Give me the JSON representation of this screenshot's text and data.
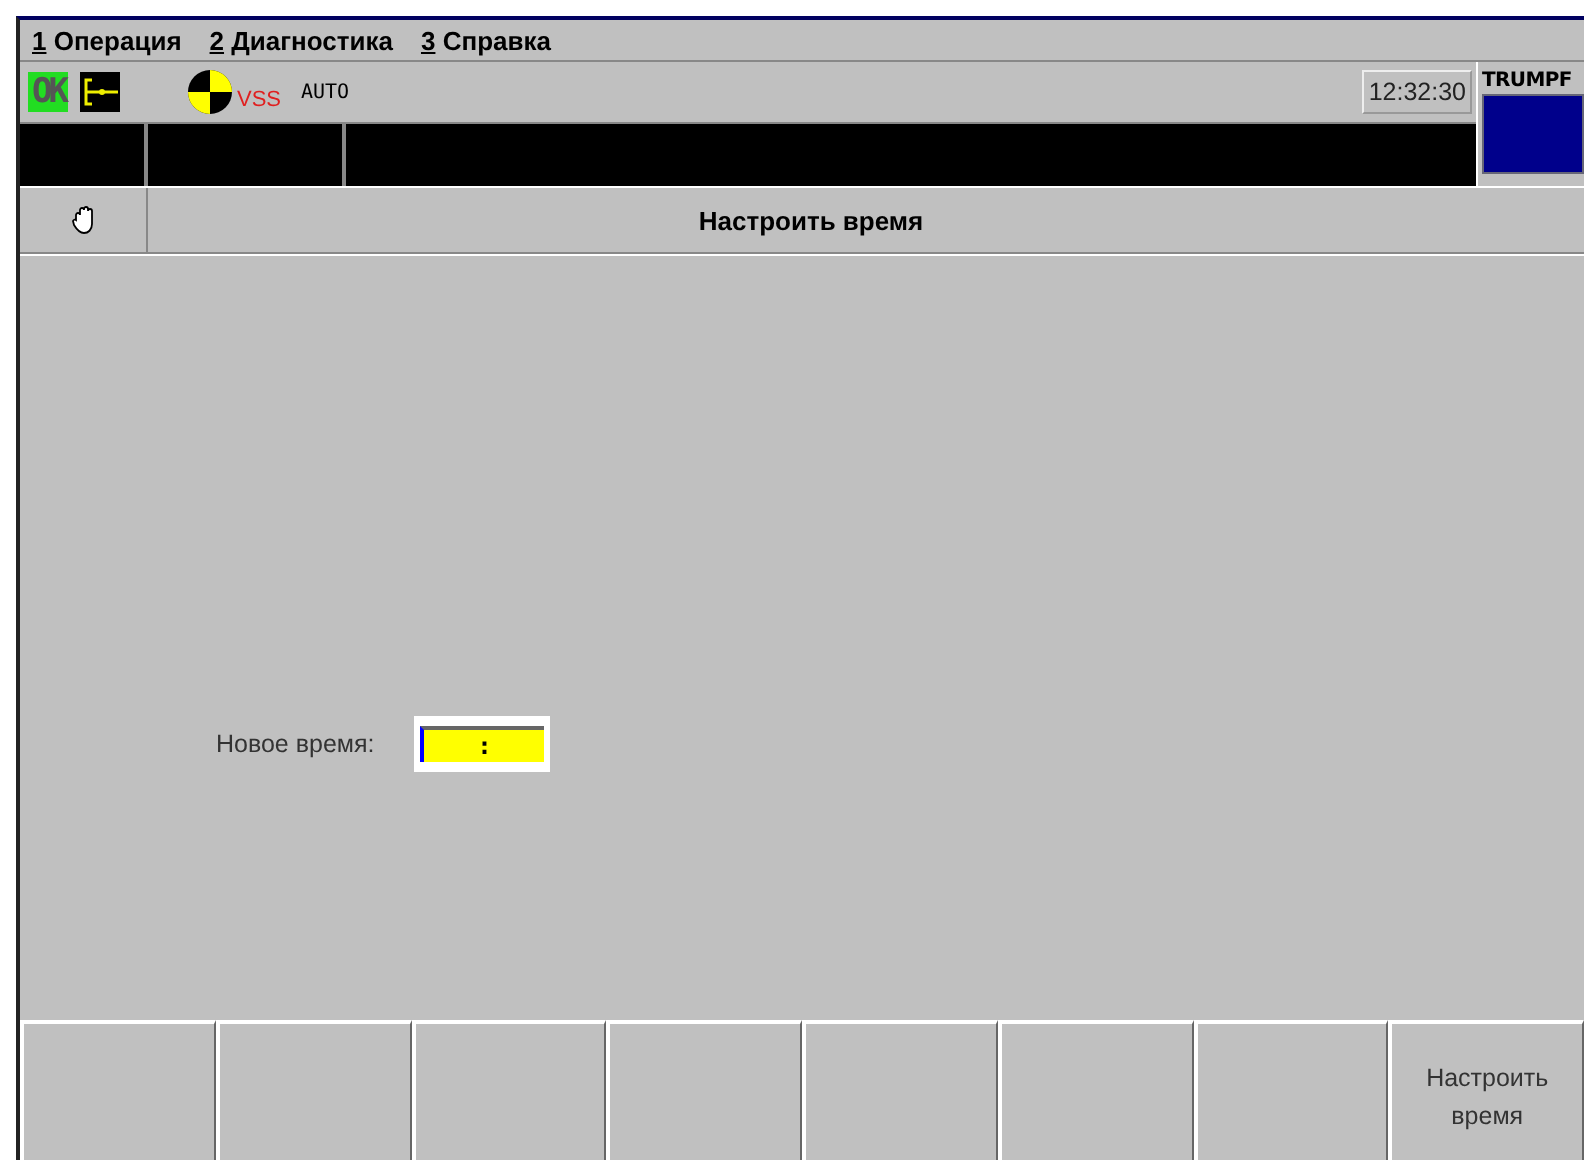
{
  "menu": [
    {
      "key": "1",
      "label": "Операция"
    },
    {
      "key": "2",
      "label": "Диагностика"
    },
    {
      "key": "3",
      "label": "Справка"
    }
  ],
  "status": {
    "ok_badge": "OK",
    "mode_mark": "VSS",
    "mode": "AUTO",
    "clock": "12:32:30",
    "logo": "TRUMPF"
  },
  "header": {
    "title": "Настроить время"
  },
  "form": {
    "label": "Новое время:",
    "value": ":"
  },
  "softkeys": [
    {
      "kind": "blank"
    },
    {
      "kind": "blank"
    },
    {
      "kind": "blank"
    },
    {
      "kind": "blank"
    },
    {
      "kind": "blank"
    },
    {
      "kind": "blank"
    },
    {
      "kind": "blank"
    },
    {
      "kind": "labeled",
      "label": "Настроить время"
    }
  ]
}
